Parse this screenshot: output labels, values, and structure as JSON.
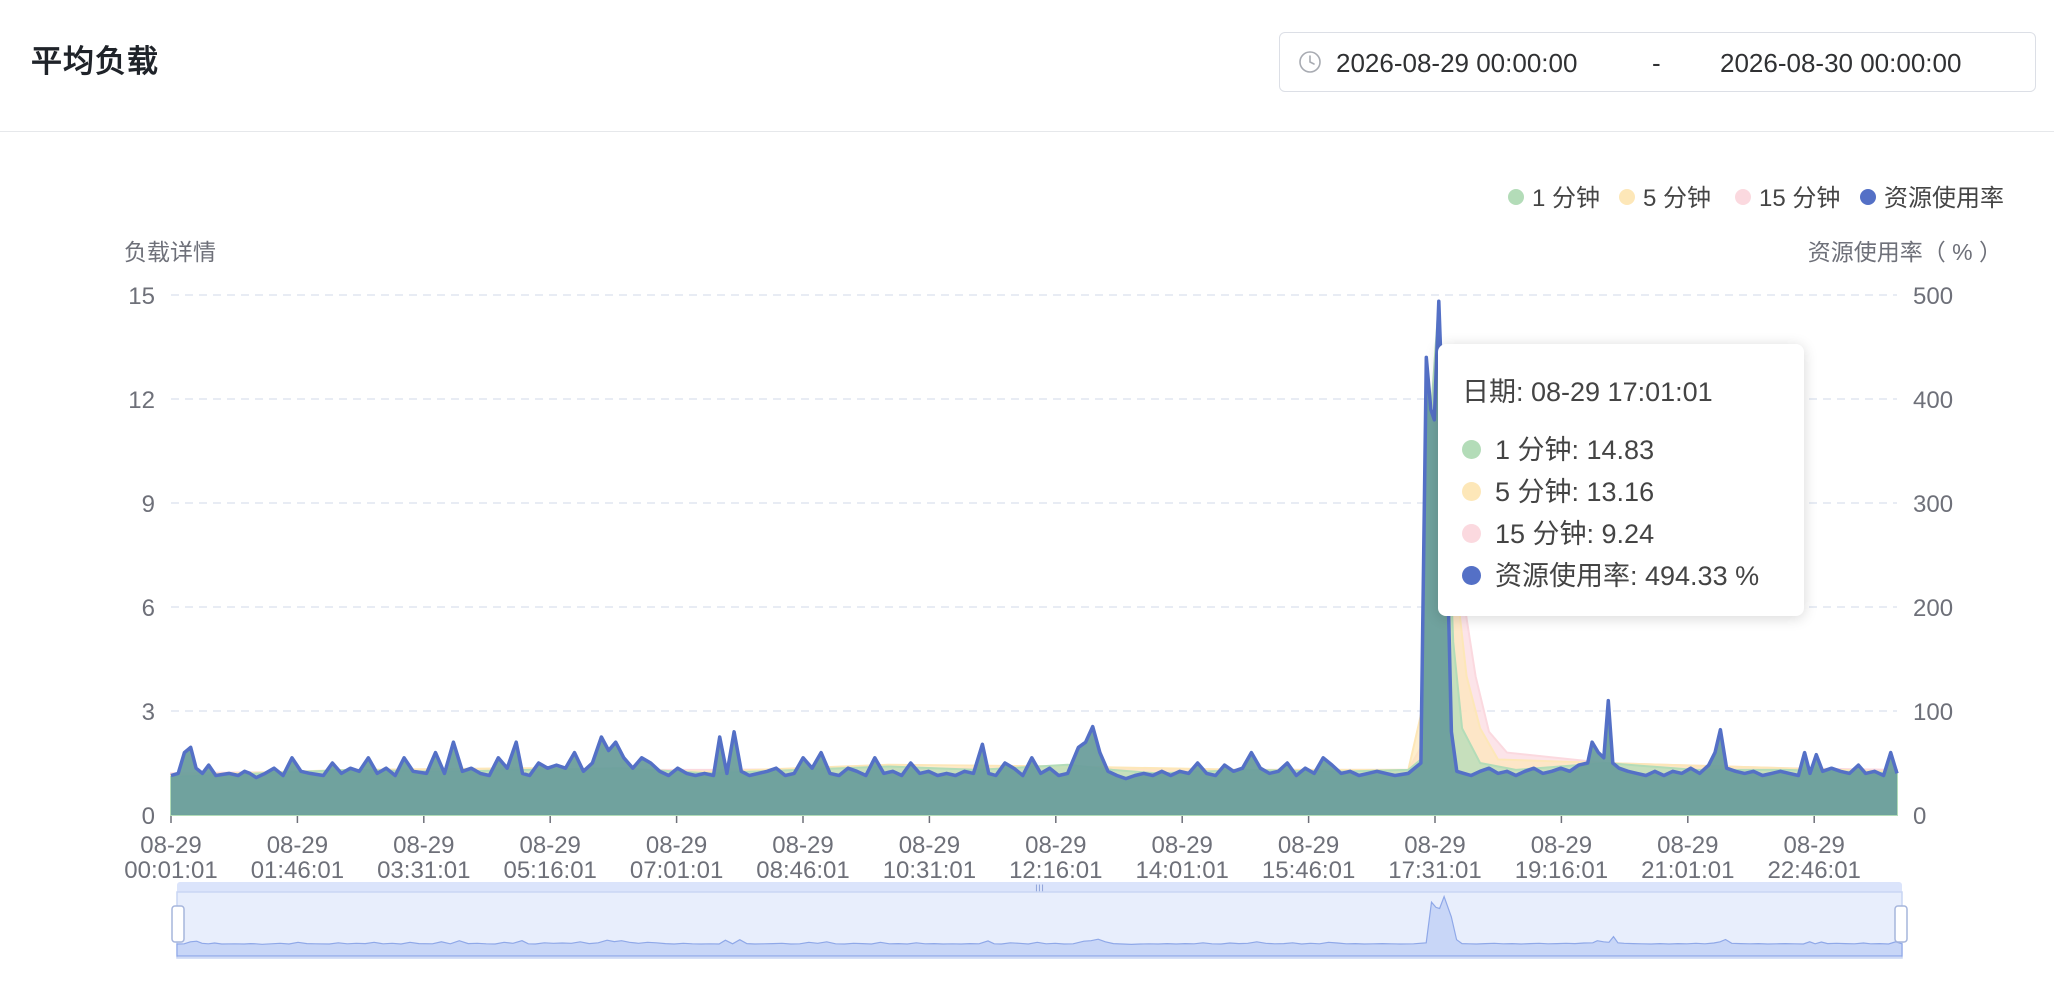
{
  "header": {
    "title": "平均负载",
    "date_range": {
      "start": "2026-08-29 00:00:00",
      "separator": "-",
      "end": "2026-08-30 00:00:00"
    }
  },
  "colors": {
    "load_1m": "#b3dcb8",
    "load_5m": "#fde7b8",
    "load_15m": "#fbd9df",
    "usage": "#5470c6",
    "area_fill": "#6b9e9c",
    "grid": "#e0e6f1",
    "axis_text": "#6e7079"
  },
  "tooltip": {
    "date": "日期: 08-29 17:01:01",
    "rows": [
      {
        "label": "1 分钟: 14.83"
      },
      {
        "label": "5 分钟: 13.16"
      },
      {
        "label": "15 分钟: 9.24"
      },
      {
        "label": "资源使用率: 494.33 %"
      }
    ]
  },
  "chart_data": {
    "type": "area",
    "legend": [
      "1 分钟",
      "5 分钟",
      "15 分钟",
      "资源使用率"
    ],
    "legend_position": "top-right",
    "ylabel_left": "负载详情",
    "ylabel_right": "资源使用率（ % ）",
    "ylim_left": [
      0,
      15
    ],
    "yticks_left": [
      "0",
      "3",
      "6",
      "9",
      "12",
      "15"
    ],
    "ylim_right": [
      0,
      500
    ],
    "yticks_right": [
      "0",
      "100",
      "200",
      "300",
      "400",
      "500"
    ],
    "grid": true,
    "x_tick_labels": [
      [
        "08-29",
        "00:01:01"
      ],
      [
        "08-29",
        "01:46:01"
      ],
      [
        "08-29",
        "03:31:01"
      ],
      [
        "08-29",
        "05:16:01"
      ],
      [
        "08-29",
        "07:01:01"
      ],
      [
        "08-29",
        "08:46:01"
      ],
      [
        "08-29",
        "10:31:01"
      ],
      [
        "08-29",
        "12:16:01"
      ],
      [
        "08-29",
        "14:01:01"
      ],
      [
        "08-29",
        "15:46:01"
      ],
      [
        "08-29",
        "17:31:01"
      ],
      [
        "08-29",
        "19:16:01"
      ],
      [
        "08-29",
        "21:01:01"
      ],
      [
        "08-29",
        "22:46:01"
      ]
    ],
    "x_start": "08-29 00:01:01",
    "x_end": "08-29 23:56:01",
    "usage_series": [
      [
        0,
        38
      ],
      [
        8,
        40
      ],
      [
        15,
        60
      ],
      [
        22,
        65
      ],
      [
        28,
        45
      ],
      [
        35,
        40
      ],
      [
        42,
        48
      ],
      [
        50,
        38
      ],
      [
        65,
        40
      ],
      [
        75,
        38
      ],
      [
        82,
        42
      ],
      [
        88,
        40
      ],
      [
        95,
        36
      ],
      [
        105,
        40
      ],
      [
        115,
        45
      ],
      [
        125,
        38
      ],
      [
        135,
        55
      ],
      [
        145,
        42
      ],
      [
        155,
        40
      ],
      [
        170,
        38
      ],
      [
        180,
        50
      ],
      [
        190,
        40
      ],
      [
        200,
        45
      ],
      [
        210,
        42
      ],
      [
        220,
        55
      ],
      [
        230,
        40
      ],
      [
        240,
        45
      ],
      [
        250,
        38
      ],
      [
        260,
        55
      ],
      [
        270,
        42
      ],
      [
        285,
        40
      ],
      [
        295,
        60
      ],
      [
        305,
        40
      ],
      [
        315,
        70
      ],
      [
        325,
        42
      ],
      [
        335,
        45
      ],
      [
        345,
        40
      ],
      [
        355,
        38
      ],
      [
        365,
        55
      ],
      [
        375,
        45
      ],
      [
        385,
        70
      ],
      [
        392,
        40
      ],
      [
        400,
        38
      ],
      [
        410,
        50
      ],
      [
        420,
        45
      ],
      [
        430,
        48
      ],
      [
        440,
        45
      ],
      [
        450,
        60
      ],
      [
        460,
        42
      ],
      [
        470,
        50
      ],
      [
        480,
        75
      ],
      [
        488,
        62
      ],
      [
        496,
        70
      ],
      [
        505,
        55
      ],
      [
        515,
        45
      ],
      [
        525,
        55
      ],
      [
        535,
        50
      ],
      [
        545,
        42
      ],
      [
        555,
        38
      ],
      [
        565,
        45
      ],
      [
        575,
        40
      ],
      [
        585,
        38
      ],
      [
        595,
        40
      ],
      [
        605,
        38
      ],
      [
        612,
        75
      ],
      [
        620,
        40
      ],
      [
        628,
        80
      ],
      [
        636,
        42
      ],
      [
        645,
        38
      ],
      [
        655,
        40
      ],
      [
        665,
        42
      ],
      [
        675,
        45
      ],
      [
        685,
        38
      ],
      [
        695,
        40
      ],
      [
        705,
        55
      ],
      [
        715,
        45
      ],
      [
        725,
        60
      ],
      [
        735,
        40
      ],
      [
        745,
        38
      ],
      [
        755,
        45
      ],
      [
        765,
        42
      ],
      [
        775,
        38
      ],
      [
        785,
        55
      ],
      [
        795,
        40
      ],
      [
        805,
        42
      ],
      [
        815,
        38
      ],
      [
        825,
        50
      ],
      [
        835,
        40
      ],
      [
        845,
        42
      ],
      [
        855,
        38
      ],
      [
        865,
        40
      ],
      [
        875,
        38
      ],
      [
        885,
        42
      ],
      [
        895,
        40
      ],
      [
        905,
        68
      ],
      [
        912,
        40
      ],
      [
        920,
        38
      ],
      [
        930,
        50
      ],
      [
        940,
        45
      ],
      [
        950,
        38
      ],
      [
        960,
        55
      ],
      [
        970,
        40
      ],
      [
        980,
        45
      ],
      [
        990,
        38
      ],
      [
        1000,
        40
      ],
      [
        1012,
        65
      ],
      [
        1020,
        70
      ],
      [
        1028,
        85
      ],
      [
        1036,
        60
      ],
      [
        1045,
        42
      ],
      [
        1055,
        38
      ],
      [
        1065,
        35
      ],
      [
        1075,
        38
      ],
      [
        1085,
        40
      ],
      [
        1095,
        38
      ],
      [
        1105,
        42
      ],
      [
        1115,
        38
      ],
      [
        1125,
        42
      ],
      [
        1135,
        40
      ],
      [
        1145,
        50
      ],
      [
        1155,
        40
      ],
      [
        1165,
        38
      ],
      [
        1175,
        48
      ],
      [
        1185,
        42
      ],
      [
        1195,
        45
      ],
      [
        1205,
        60
      ],
      [
        1215,
        45
      ],
      [
        1225,
        40
      ],
      [
        1235,
        42
      ],
      [
        1245,
        50
      ],
      [
        1255,
        38
      ],
      [
        1265,
        45
      ],
      [
        1275,
        40
      ],
      [
        1285,
        55
      ],
      [
        1295,
        48
      ],
      [
        1305,
        40
      ],
      [
        1315,
        42
      ],
      [
        1325,
        38
      ],
      [
        1335,
        40
      ],
      [
        1345,
        42
      ],
      [
        1355,
        40
      ],
      [
        1365,
        38
      ],
      [
        1380,
        40
      ],
      [
        1394,
        50
      ],
      [
        1400,
        440
      ],
      [
        1405,
        390
      ],
      [
        1409,
        380
      ],
      [
        1414,
        494
      ],
      [
        1422,
        300
      ],
      [
        1428,
        80
      ],
      [
        1434,
        42
      ],
      [
        1442,
        40
      ],
      [
        1450,
        38
      ],
      [
        1460,
        42
      ],
      [
        1470,
        45
      ],
      [
        1480,
        40
      ],
      [
        1490,
        42
      ],
      [
        1500,
        38
      ],
      [
        1510,
        42
      ],
      [
        1520,
        45
      ],
      [
        1530,
        40
      ],
      [
        1540,
        42
      ],
      [
        1550,
        45
      ],
      [
        1560,
        42
      ],
      [
        1570,
        48
      ],
      [
        1580,
        50
      ],
      [
        1585,
        70
      ],
      [
        1592,
        60
      ],
      [
        1598,
        55
      ],
      [
        1603,
        110
      ],
      [
        1608,
        50
      ],
      [
        1615,
        45
      ],
      [
        1625,
        42
      ],
      [
        1635,
        40
      ],
      [
        1645,
        38
      ],
      [
        1655,
        42
      ],
      [
        1665,
        38
      ],
      [
        1675,
        42
      ],
      [
        1685,
        40
      ],
      [
        1695,
        45
      ],
      [
        1705,
        40
      ],
      [
        1715,
        48
      ],
      [
        1722,
        60
      ],
      [
        1728,
        82
      ],
      [
        1735,
        45
      ],
      [
        1745,
        42
      ],
      [
        1755,
        40
      ],
      [
        1765,
        42
      ],
      [
        1775,
        38
      ],
      [
        1785,
        40
      ],
      [
        1795,
        42
      ],
      [
        1805,
        40
      ],
      [
        1815,
        38
      ],
      [
        1822,
        60
      ],
      [
        1828,
        40
      ],
      [
        1835,
        58
      ],
      [
        1842,
        42
      ],
      [
        1852,
        45
      ],
      [
        1862,
        42
      ],
      [
        1872,
        40
      ],
      [
        1882,
        48
      ],
      [
        1890,
        40
      ],
      [
        1900,
        42
      ],
      [
        1910,
        38
      ],
      [
        1918,
        60
      ],
      [
        1925,
        40
      ]
    ],
    "load_1m_series": [
      [
        0,
        1.1
      ],
      [
        100,
        1.2
      ],
      [
        200,
        1.3
      ],
      [
        300,
        1.25
      ],
      [
        400,
        1.3
      ],
      [
        500,
        1.35
      ],
      [
        600,
        1.2
      ],
      [
        700,
        1.3
      ],
      [
        800,
        1.4
      ],
      [
        900,
        1.3
      ],
      [
        1000,
        1.45
      ],
      [
        1050,
        1.3
      ],
      [
        1100,
        1.2
      ],
      [
        1200,
        1.3
      ],
      [
        1300,
        1.25
      ],
      [
        1380,
        1.3
      ],
      [
        1394,
        1.6
      ],
      [
        1400,
        12.0
      ],
      [
        1405,
        11.5
      ],
      [
        1414,
        14.83
      ],
      [
        1422,
        10.5
      ],
      [
        1430,
        5.0
      ],
      [
        1440,
        2.5
      ],
      [
        1460,
        1.5
      ],
      [
        1500,
        1.3
      ],
      [
        1600,
        1.5
      ],
      [
        1700,
        1.3
      ],
      [
        1800,
        1.3
      ],
      [
        1925,
        1.2
      ]
    ],
    "load_5m_series": [
      [
        0,
        1.15
      ],
      [
        200,
        1.3
      ],
      [
        400,
        1.35
      ],
      [
        600,
        1.25
      ],
      [
        800,
        1.45
      ],
      [
        1000,
        1.4
      ],
      [
        1200,
        1.3
      ],
      [
        1380,
        1.3
      ],
      [
        1395,
        3.0
      ],
      [
        1405,
        9.0
      ],
      [
        1414,
        13.16
      ],
      [
        1422,
        11.5
      ],
      [
        1432,
        7.0
      ],
      [
        1445,
        4.0
      ],
      [
        1460,
        2.5
      ],
      [
        1480,
        1.6
      ],
      [
        1600,
        1.5
      ],
      [
        1800,
        1.35
      ],
      [
        1925,
        1.25
      ]
    ],
    "load_15m_series": [
      [
        0,
        1.2
      ],
      [
        300,
        1.3
      ],
      [
        600,
        1.3
      ],
      [
        900,
        1.35
      ],
      [
        1200,
        1.3
      ],
      [
        1380,
        1.3
      ],
      [
        1395,
        2.0
      ],
      [
        1405,
        6.0
      ],
      [
        1414,
        9.24
      ],
      [
        1425,
        8.8
      ],
      [
        1440,
        6.5
      ],
      [
        1455,
        4.0
      ],
      [
        1470,
        2.4
      ],
      [
        1490,
        1.8
      ],
      [
        1600,
        1.5
      ],
      [
        1800,
        1.35
      ],
      [
        1925,
        1.3
      ]
    ]
  }
}
